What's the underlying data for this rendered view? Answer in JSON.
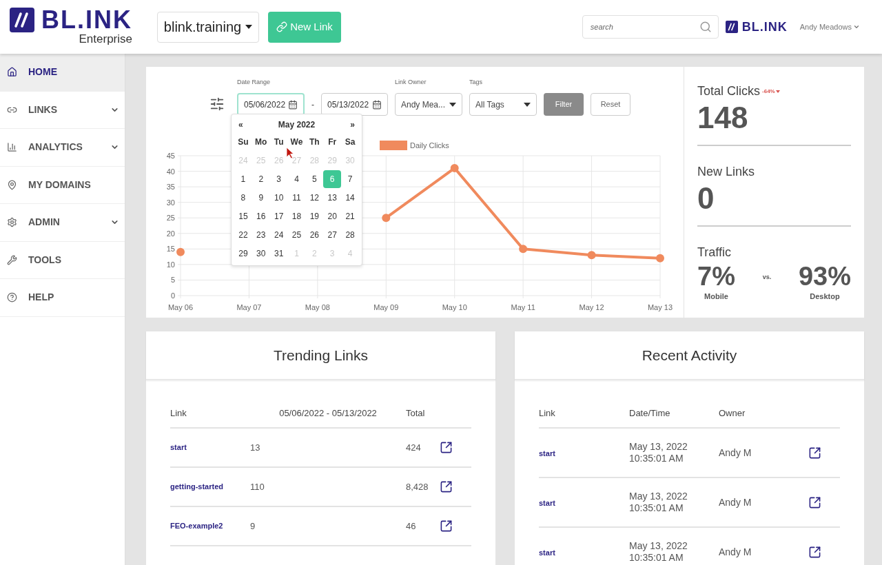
{
  "header": {
    "logo": {
      "wordmark": "BL.INK",
      "subtitle": "Enterprise"
    },
    "domain_select": {
      "value": "blink.training"
    },
    "new_link_button": {
      "label": "New Link"
    },
    "search": {
      "placeholder": "search"
    },
    "small_logo": {
      "wordmark": "BL.INK"
    },
    "user_menu": {
      "label": "Andy Meadows"
    }
  },
  "sidebar": {
    "items": [
      {
        "label": "HOME",
        "selected": true,
        "expandable": false
      },
      {
        "label": "LINKS",
        "selected": false,
        "expandable": true
      },
      {
        "label": "ANALYTICS",
        "selected": false,
        "expandable": true
      },
      {
        "label": "MY DOMAINS",
        "selected": false,
        "expandable": false
      },
      {
        "label": "ADMIN",
        "selected": false,
        "expandable": true
      },
      {
        "label": "TOOLS",
        "selected": false,
        "expandable": false
      },
      {
        "label": "HELP",
        "selected": false,
        "expandable": false
      }
    ]
  },
  "filters": {
    "date_range": {
      "label": "Date Range",
      "start": "05/06/2022",
      "end": "05/13/2022",
      "separator": "-",
      "focused": true
    },
    "link_owner": {
      "label": "Link Owner",
      "value": "Andy Mea..."
    },
    "tags": {
      "label": "Tags",
      "value": "All Tags"
    },
    "buttons": [
      {
        "label": "Filter",
        "kind": "primary"
      },
      {
        "label": "Reset",
        "kind": "secondary"
      }
    ]
  },
  "calendar": {
    "prev": "«",
    "title": "May 2022",
    "next": "»",
    "weekdays": [
      "Su",
      "Mo",
      "Tu",
      "We",
      "Th",
      "Fr",
      "Sa"
    ],
    "weeks": [
      [
        {
          "day": "24",
          "muted": true,
          "selected": false
        },
        {
          "day": "25",
          "muted": true,
          "selected": false
        },
        {
          "day": "26",
          "muted": true,
          "selected": false
        },
        {
          "day": "27",
          "muted": true,
          "selected": false
        },
        {
          "day": "28",
          "muted": true,
          "selected": false
        },
        {
          "day": "29",
          "muted": true,
          "selected": false
        },
        {
          "day": "30",
          "muted": true,
          "selected": false
        }
      ],
      [
        {
          "day": "1",
          "muted": false,
          "selected": false
        },
        {
          "day": "2",
          "muted": false,
          "selected": false
        },
        {
          "day": "3",
          "muted": false,
          "selected": false
        },
        {
          "day": "4",
          "muted": false,
          "selected": false
        },
        {
          "day": "5",
          "muted": false,
          "selected": false
        },
        {
          "day": "6",
          "muted": false,
          "selected": true
        },
        {
          "day": "7",
          "muted": false,
          "selected": false
        }
      ],
      [
        {
          "day": "8",
          "muted": false,
          "selected": false
        },
        {
          "day": "9",
          "muted": false,
          "selected": false
        },
        {
          "day": "10",
          "muted": false,
          "selected": false
        },
        {
          "day": "11",
          "muted": false,
          "selected": false
        },
        {
          "day": "12",
          "muted": false,
          "selected": false
        },
        {
          "day": "13",
          "muted": false,
          "selected": false
        },
        {
          "day": "14",
          "muted": false,
          "selected": false
        }
      ],
      [
        {
          "day": "15",
          "muted": false,
          "selected": false
        },
        {
          "day": "16",
          "muted": false,
          "selected": false
        },
        {
          "day": "17",
          "muted": false,
          "selected": false
        },
        {
          "day": "18",
          "muted": false,
          "selected": false
        },
        {
          "day": "19",
          "muted": false,
          "selected": false
        },
        {
          "day": "20",
          "muted": false,
          "selected": false
        },
        {
          "day": "21",
          "muted": false,
          "selected": false
        }
      ],
      [
        {
          "day": "22",
          "muted": false,
          "selected": false
        },
        {
          "day": "23",
          "muted": false,
          "selected": false
        },
        {
          "day": "24",
          "muted": false,
          "selected": false
        },
        {
          "day": "25",
          "muted": false,
          "selected": false
        },
        {
          "day": "26",
          "muted": false,
          "selected": false
        },
        {
          "day": "27",
          "muted": false,
          "selected": false
        },
        {
          "day": "28",
          "muted": false,
          "selected": false
        }
      ],
      [
        {
          "day": "29",
          "muted": false,
          "selected": false
        },
        {
          "day": "30",
          "muted": false,
          "selected": false
        },
        {
          "day": "31",
          "muted": false,
          "selected": false
        },
        {
          "day": "1",
          "muted": true,
          "selected": false
        },
        {
          "day": "2",
          "muted": true,
          "selected": false
        },
        {
          "day": "3",
          "muted": true,
          "selected": false
        },
        {
          "day": "4",
          "muted": true,
          "selected": false
        }
      ]
    ]
  },
  "chart": {
    "chart_data": {
      "type": "line",
      "categories": [
        "May 06",
        "May 07",
        "May 08",
        "May 09",
        "May 10",
        "May 11",
        "May 12",
        "May 13"
      ],
      "series": [
        {
          "name": "Daily Clicks",
          "color": "#f08a5d",
          "marker": "circle",
          "values": [
            14,
            null,
            null,
            25,
            41,
            15,
            13,
            12
          ]
        }
      ],
      "ylim": [
        0,
        45
      ],
      "yticks": [
        0,
        5,
        10,
        15,
        20,
        25,
        30,
        35,
        40,
        45
      ],
      "grid": true
    }
  },
  "stats": {
    "total_clicks": {
      "label": "Total Clicks",
      "value": "148",
      "change": {
        "text": "-64%"
      }
    },
    "new_links": {
      "label": "New Links",
      "value": "0"
    },
    "traffic": {
      "label": "Traffic",
      "mobile": {
        "value": "7%",
        "label": "Mobile"
      },
      "vs": "vs.",
      "desktop": {
        "value": "93%",
        "label": "Desktop"
      }
    }
  },
  "trending_links": {
    "title": "Trending Links",
    "columns": [
      "Link",
      "05/06/2022 - 05/13/2022",
      "Total"
    ],
    "rows": [
      {
        "link": "start",
        "period": "13",
        "total": "424"
      },
      {
        "link": "getting-started",
        "period": "110",
        "total": "8,428"
      },
      {
        "link": "FEO-example2",
        "period": "9",
        "total": "46"
      }
    ]
  },
  "recent_activity": {
    "title": "Recent Activity",
    "columns": [
      "Link",
      "Date/Time",
      "Owner"
    ],
    "rows": [
      {
        "link": "start",
        "date": "May 13, 2022",
        "time": "10:35:01 AM",
        "owner": "Andy M"
      },
      {
        "link": "start",
        "date": "May 13, 2022",
        "time": "10:35:01 AM",
        "owner": "Andy M"
      },
      {
        "link": "start",
        "date": "May 13, 2022",
        "time": "10:35:01 AM",
        "owner": "Andy M"
      }
    ]
  }
}
